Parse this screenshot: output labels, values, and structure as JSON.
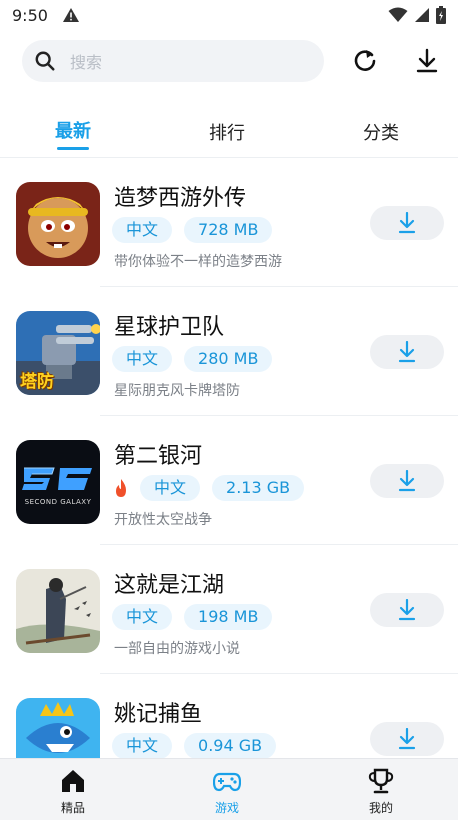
{
  "status_bar": {
    "time": "9:50"
  },
  "search": {
    "placeholder": "搜索"
  },
  "tabs": [
    {
      "label": "最新",
      "active": true
    },
    {
      "label": "排行",
      "active": false
    },
    {
      "label": "分类",
      "active": false
    }
  ],
  "games": [
    {
      "title": "造梦西游外传",
      "tags": [
        "中文",
        "728 MB"
      ],
      "hot": false,
      "desc": "带你体验不一样的造梦西游",
      "icon": "monkey-king-game-icon"
    },
    {
      "title": "星球护卫队",
      "tags": [
        "中文",
        "280 MB"
      ],
      "hot": false,
      "desc": "星际朋克风卡牌塔防",
      "icon": "tower-defense-game-icon",
      "icon_text": "塔防"
    },
    {
      "title": "第二银河",
      "tags": [
        "中文",
        "2.13 GB"
      ],
      "hot": true,
      "desc": "开放性太空战争",
      "icon": "second-galaxy-game-icon",
      "icon_text": "SECOND GALAXY"
    },
    {
      "title": "这就是江湖",
      "tags": [
        "中文",
        "198 MB"
      ],
      "hot": false,
      "desc": "一部自由的游戏小说",
      "icon": "jianghu-game-icon"
    },
    {
      "title": "姚记捕鱼",
      "tags": [
        "中文",
        "0.94 GB"
      ],
      "hot": false,
      "desc": "",
      "icon": "fishing-game-icon"
    }
  ],
  "bottom_nav": [
    {
      "label": "精品",
      "icon": "home-icon",
      "active": false
    },
    {
      "label": "游戏",
      "icon": "gamepad-icon",
      "active": true
    },
    {
      "label": "我的",
      "icon": "trophy-icon",
      "active": false
    }
  ],
  "colors": {
    "accent": "#1aa0e8",
    "tag_bg": "#e9f5fd",
    "search_bg": "#f1f3f6"
  }
}
